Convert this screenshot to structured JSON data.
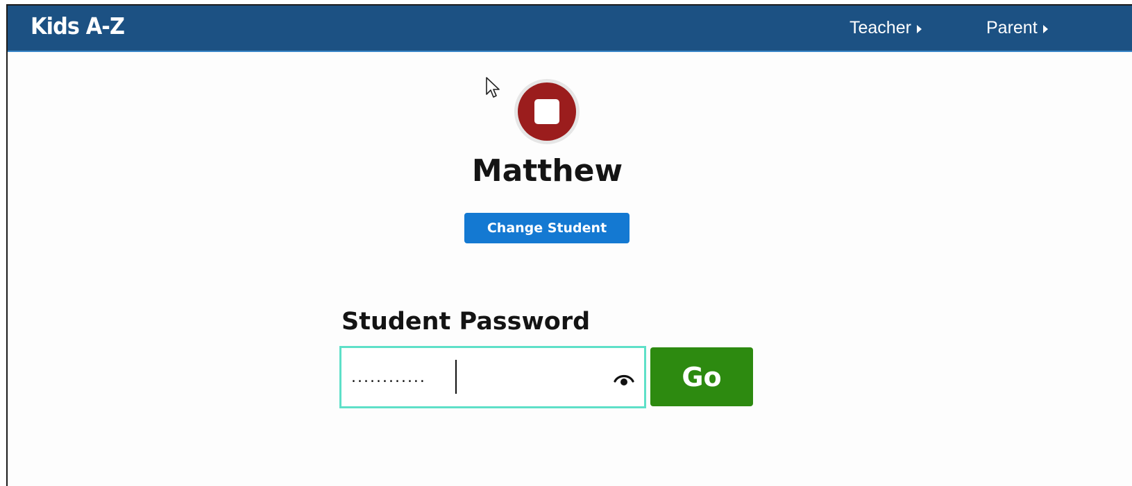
{
  "header": {
    "logo_text": "Kids A-Z",
    "nav": [
      {
        "label": "Teacher"
      },
      {
        "label": "Parent"
      }
    ],
    "background_color": "#1c5183"
  },
  "student": {
    "name": "Matthew",
    "avatar_icon": "stop-square-avatar",
    "avatar_color": "#9b1d1d",
    "change_button_label": "Change Student"
  },
  "login": {
    "password_label": "Student Password",
    "password_value": "............",
    "show_password_icon": "eye-icon",
    "go_button_label": "Go",
    "go_button_color": "#2d8a10"
  }
}
